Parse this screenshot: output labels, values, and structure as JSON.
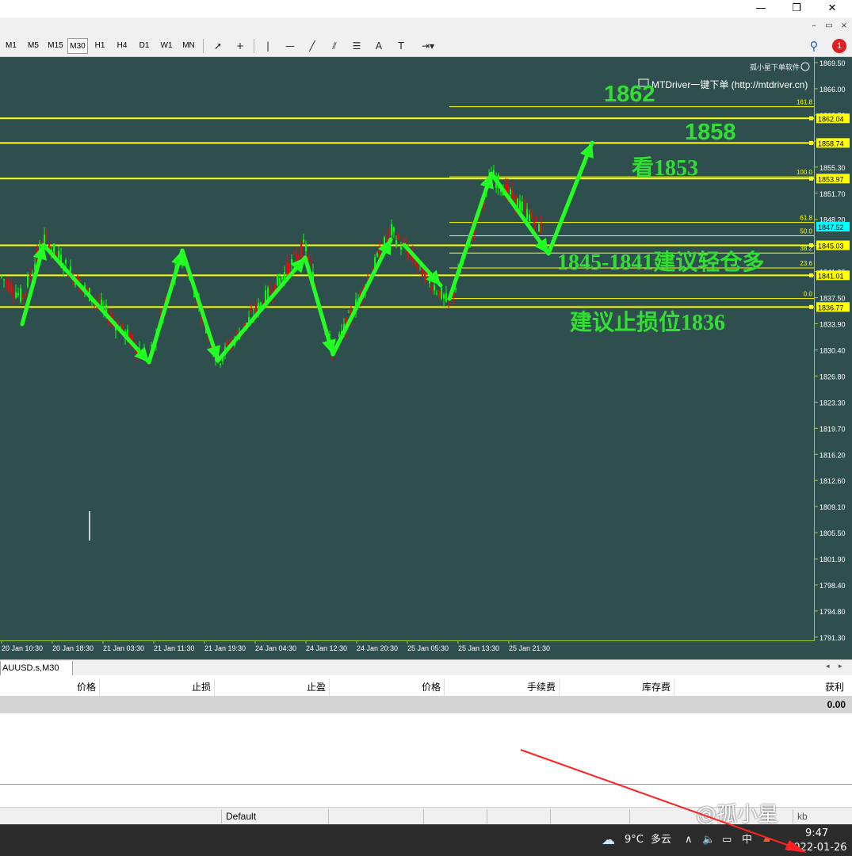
{
  "window": {
    "minimize_glyph": "—",
    "restore_glyph": "❐",
    "close_glyph": "✕"
  },
  "mdi": {
    "minimize_glyph": "–",
    "restore_glyph": "▭",
    "close_glyph": "×"
  },
  "toolbar": {
    "timeframes": [
      "M1",
      "M5",
      "M15",
      "M30",
      "H1",
      "H4",
      "D1",
      "W1",
      "MN"
    ],
    "active_timeframe": "M30",
    "tools": [
      {
        "name": "cursor-tool",
        "glyph": "➚"
      },
      {
        "name": "crosshair-tool",
        "glyph": "+"
      },
      {
        "name": "vertical-line-tool",
        "glyph": "|"
      },
      {
        "name": "horizontal-line-tool",
        "glyph": "—"
      },
      {
        "name": "trendline-tool",
        "glyph": "╱"
      },
      {
        "name": "equidistant-channel-tool",
        "glyph": "⫽"
      },
      {
        "name": "fibonacci-tool",
        "glyph": "☰"
      },
      {
        "name": "text-tool",
        "glyph": "A"
      },
      {
        "name": "text-label-tool",
        "glyph": "T"
      },
      {
        "name": "arrows-dropdown-tool",
        "glyph": "⇥▾"
      }
    ],
    "search_glyph": "⚲",
    "notification_count": "1"
  },
  "chart": {
    "background": "#2f4f4f",
    "bull_color": "#00ff00",
    "bear_color": "#ff0000",
    "line_color": "#ffff00",
    "arrow_color": "#22ff22",
    "corner_label": "孤小星下单软件",
    "mtdriver_label": "MTDriver一键下单 (http://mtdriver.cn)",
    "y_ticks": [
      "1869.50",
      "1866.00",
      "1862.70",
      "1859.20",
      "1855.30",
      "1851.70",
      "1848.20",
      "1844.90",
      "1841.30",
      "1837.50",
      "1833.90",
      "1830.40",
      "1826.80",
      "1823.30",
      "1819.70",
      "1816.20",
      "1812.60",
      "1809.10",
      "1805.50",
      "1801.90",
      "1798.40",
      "1794.80",
      "1791.30"
    ],
    "x_ticks": [
      "20 Jan 10:30",
      "20 Jan 18:30",
      "21 Jan 03:30",
      "21 Jan 11:30",
      "21 Jan 19:30",
      "24 Jan 04:30",
      "24 Jan 12:30",
      "24 Jan 20:30",
      "25 Jan 05:30",
      "25 Jan 13:30",
      "25 Jan 21:30"
    ],
    "levels": [
      {
        "price": 1862.04,
        "label": "1862.04"
      },
      {
        "price": 1858.74,
        "label": "1858.74"
      },
      {
        "price": 1853.97,
        "label": "1853.97"
      },
      {
        "price": 1845.03,
        "label": "1845.03"
      },
      {
        "price": 1841.01,
        "label": "1841.01"
      },
      {
        "price": 1836.77,
        "label": "1836.77"
      }
    ],
    "current_price": "1847.52",
    "fib_levels": [
      {
        "ratio": "161.8",
        "price": 1863.6
      },
      {
        "ratio": "100.0",
        "price": 1854.2
      },
      {
        "ratio": "61.8",
        "price": 1848.1
      },
      {
        "ratio": "50.0",
        "price": 1846.3
      },
      {
        "ratio": "38.2",
        "price": 1844.0
      },
      {
        "ratio": "23.6",
        "price": 1842.0
      },
      {
        "ratio": "0.0",
        "price": 1837.9
      }
    ],
    "annotations": {
      "target_1862": "1862",
      "target_1858": "1858",
      "target_1853": "看1853",
      "buy_zone": "1845-1841建议轻仓多",
      "stop_loss": "建议止损位1836"
    }
  },
  "symbol_tab": "AUUSD.s,M30",
  "terminal": {
    "columns": [
      "价格",
      "止损",
      "止盈",
      "价格",
      "手续费",
      "库存费",
      "获利"
    ],
    "total_profit": "0.00"
  },
  "statusbar": {
    "profile": "Default",
    "trailing_label": "kb"
  },
  "taskbar": {
    "weather_temp": "9°C",
    "weather_text": "多云",
    "ime_label": "中",
    "time": "9:47",
    "date": "2022-01-26",
    "weibo_watermark": "@孤小星"
  }
}
